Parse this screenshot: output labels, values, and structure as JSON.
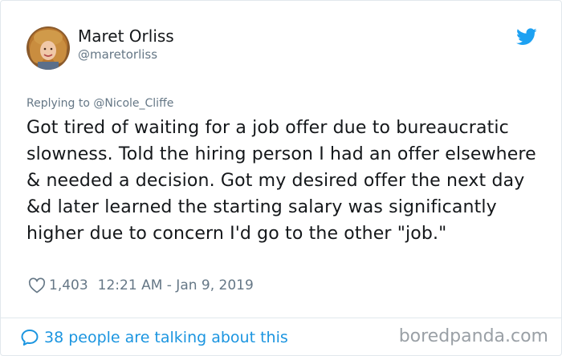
{
  "user": {
    "display_name": "Maret Orliss",
    "handle": "@maretorliss"
  },
  "reply": {
    "prefix": "Replying to",
    "mention": "@Nicole_Cliffe"
  },
  "tweet": {
    "text": "Got tired of waiting for a job offer due to bureaucratic slowness. Told the hiring person I had an offer elsewhere & needed a decision. Got my desired offer the next day &d later learned the starting salary was significantly higher due to concern I'd go to the other \"job.\""
  },
  "meta": {
    "likes": "1,403",
    "timestamp": "12:21 AM - Jan 9, 2019"
  },
  "footer": {
    "talking_label": "38 people are talking about this"
  },
  "watermark": "boredpanda.com",
  "colors": {
    "twitter_blue": "#1da1f2",
    "link_blue": "#1b95e0",
    "secondary_text": "#657786",
    "primary_text": "#14171a"
  },
  "icons": {
    "brand": "twitter-bird-icon",
    "like": "heart-icon",
    "replies": "speech-bubble-icon"
  }
}
